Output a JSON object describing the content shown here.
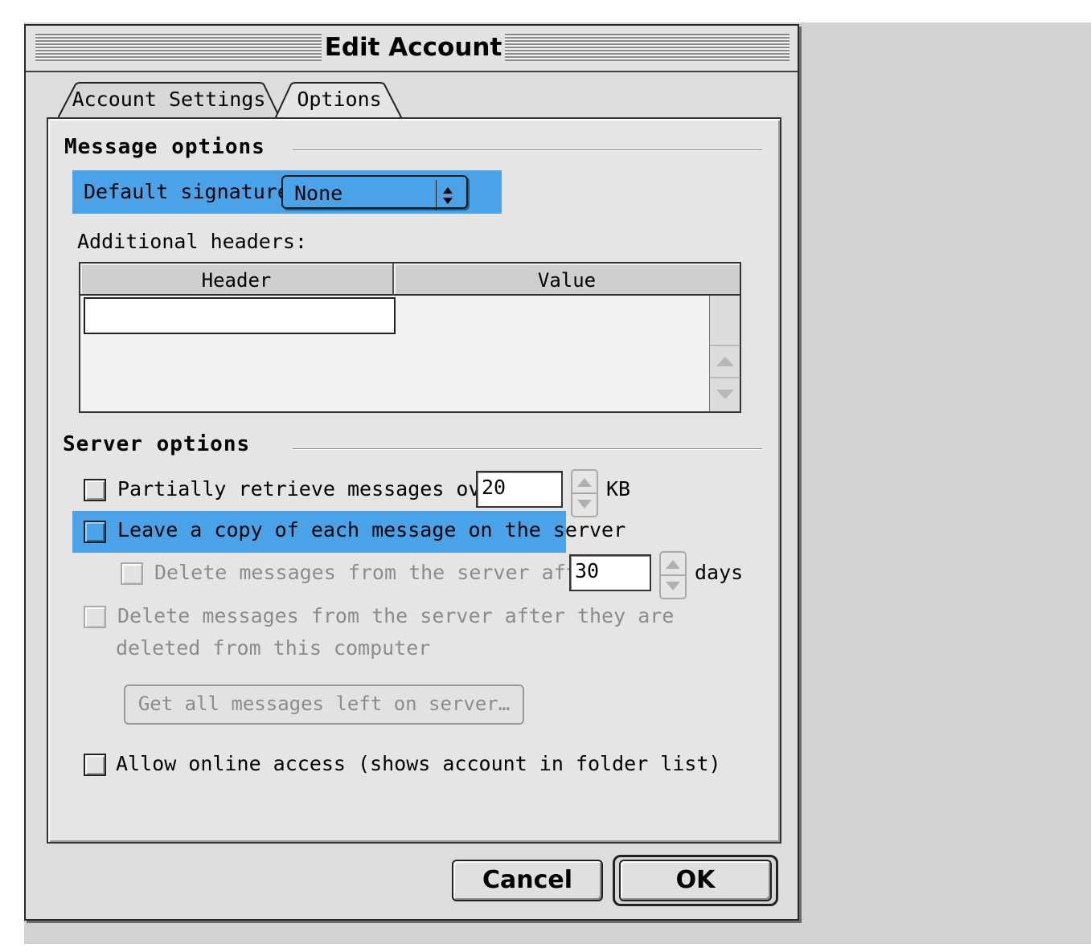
{
  "window": {
    "title": "Edit Account"
  },
  "tabs": [
    {
      "label": "Account Settings",
      "active": false
    },
    {
      "label": "Options",
      "active": true
    }
  ],
  "message_options": {
    "section_title": "Message options",
    "default_signature_label": "Default signature:",
    "default_signature_value": "None",
    "additional_headers_label": "Additional headers:",
    "table": {
      "columns": [
        "Header",
        "Value"
      ],
      "rows": []
    }
  },
  "server_options": {
    "section_title": "Server options",
    "partial_retrieve": {
      "label": "Partially retrieve messages over",
      "value": "20",
      "unit": "KB",
      "checked": false
    },
    "leave_copy": {
      "label": "Leave a copy of each message on the server",
      "checked": false,
      "highlighted": true
    },
    "delete_after_days": {
      "label": "Delete messages from the server after",
      "value": "30",
      "unit": "days",
      "checked": false,
      "enabled": false
    },
    "delete_after_local": {
      "label_line1": "Delete messages from the server after they are",
      "label_line2": "deleted from this computer",
      "checked": false,
      "enabled": false
    },
    "get_all_button": "Get all messages left on server…",
    "online_access": {
      "label": "Allow online access (shows account in folder list)",
      "checked": false
    }
  },
  "buttons": {
    "cancel": "Cancel",
    "ok": "OK"
  },
  "colors": {
    "highlight": "#4aa3e8",
    "window_bg": "#dddddd",
    "panel_bg": "#e5e5e5"
  }
}
